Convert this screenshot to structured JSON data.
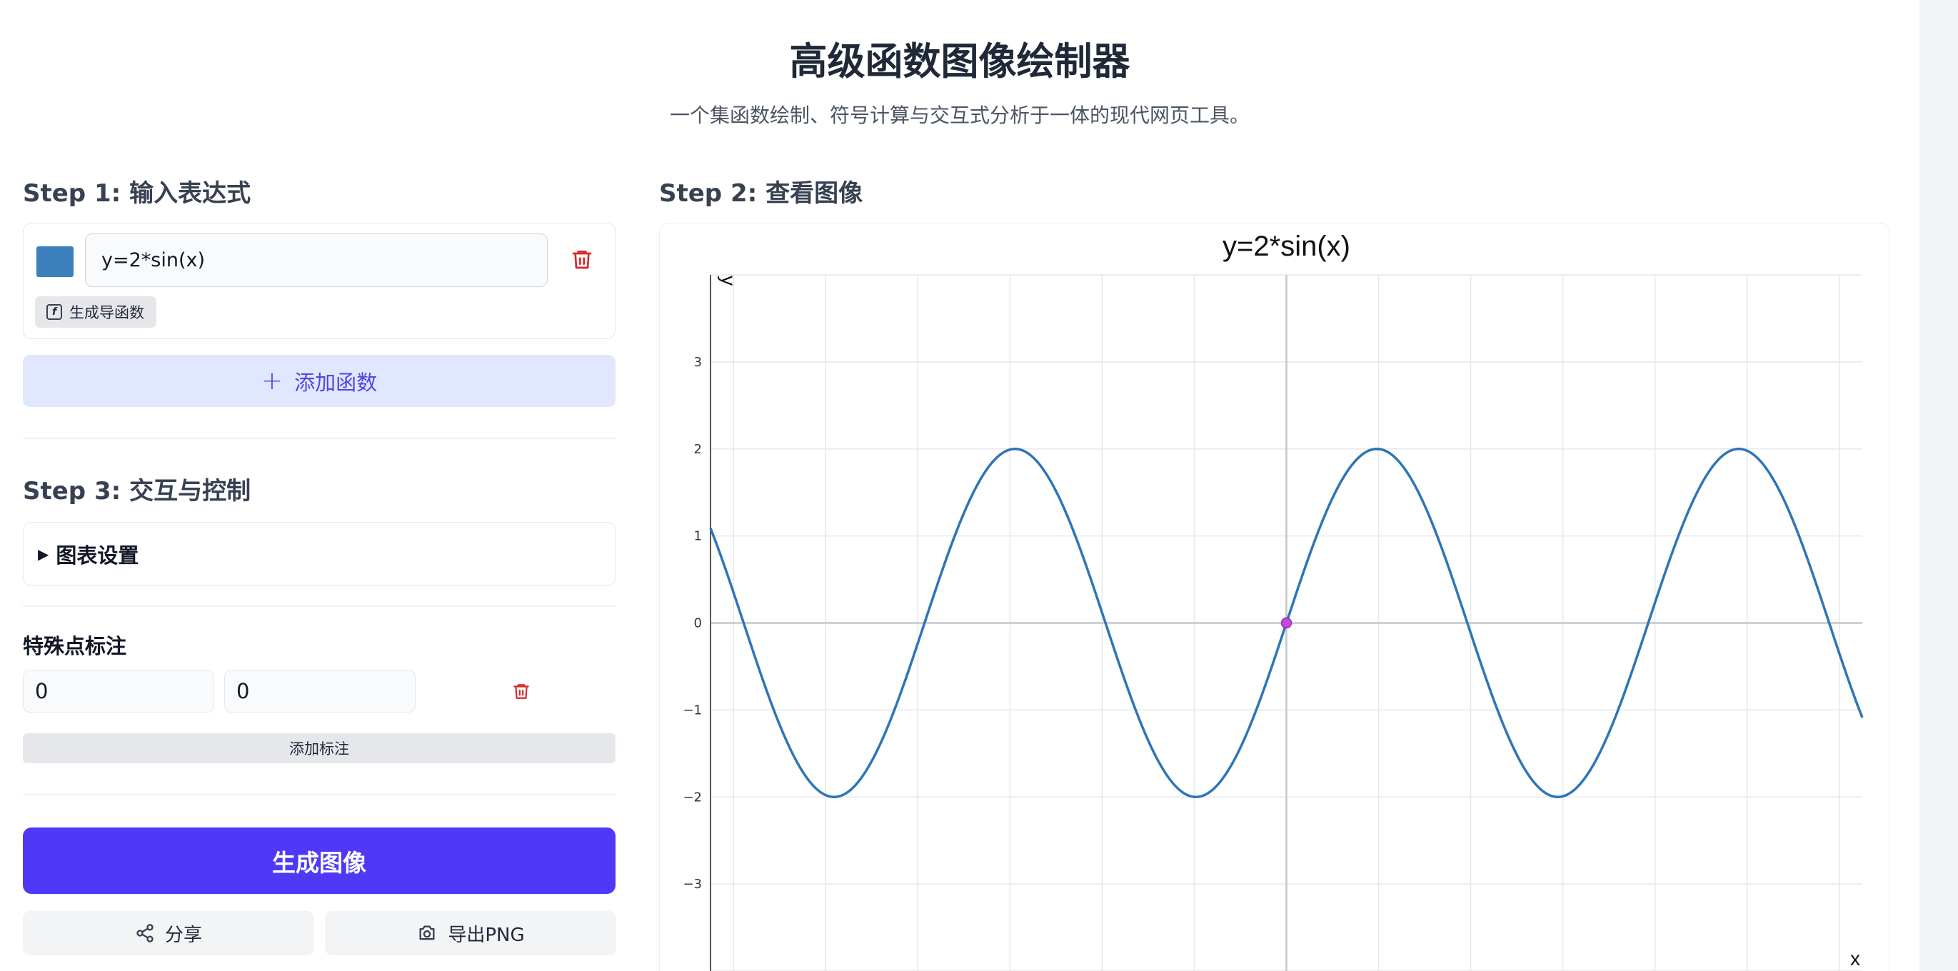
{
  "header": {
    "title": "高级函数图像绘制器",
    "subtitle": "一个集函数绘制、符号计算与交互式分析于一体的现代网页工具。"
  },
  "step1": {
    "heading": "Step 1: 输入表达式",
    "function": {
      "color": "#3b7fbd",
      "expression": "y=2*sin(x)",
      "derivative_label": "生成导函数"
    },
    "add_function_label": "添加函数"
  },
  "step2": {
    "heading": "Step 2: 查看图像"
  },
  "step3": {
    "heading": "Step 3: 交互与控制",
    "settings_label": "图表设置",
    "annotation_label": "特殊点标注",
    "point_x": "0",
    "point_y": "0",
    "add_annotation_label": "添加标注"
  },
  "actions": {
    "generate_label": "生成图像",
    "share_label": "分享",
    "export_label": "导出PNG"
  },
  "colors": {
    "accent": "#4f39f6",
    "curve": "#2e75b6",
    "marker": "#c04dd8",
    "danger": "#dc2626"
  },
  "chart_data": {
    "type": "line",
    "title": "y=2*sin(x)",
    "xlabel": "x",
    "ylabel": "y",
    "xlim": [
      -10,
      10
    ],
    "ylim": [
      -4,
      4
    ],
    "yticks": [
      "3",
      "2",
      "1",
      "0",
      "−1",
      "−2",
      "−3"
    ],
    "ytick_values": [
      3,
      2,
      1,
      0,
      -1,
      -2,
      -3
    ],
    "grid": true,
    "series": [
      {
        "expression": "2*sin(x)",
        "x": [
          -10,
          -9,
          -8,
          -7,
          -6,
          -5,
          -4,
          -3,
          -2,
          -1,
          0,
          1,
          2,
          3,
          4,
          5,
          6,
          7,
          8,
          9,
          10
        ],
        "y": [
          1.09,
          -0.82,
          -1.98,
          -1.31,
          0.56,
          1.92,
          1.51,
          -0.28,
          -1.82,
          -1.68,
          0,
          1.68,
          1.82,
          0.28,
          -1.51,
          -1.92,
          -0.56,
          1.31,
          1.98,
          0.82,
          -1.09
        ]
      }
    ],
    "annotations": [
      {
        "x": 0,
        "y": 0
      }
    ]
  }
}
